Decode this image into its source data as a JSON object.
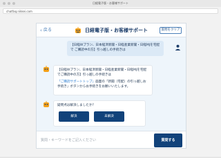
{
  "browser": {
    "window_title": "日経電子版・お客様サポート",
    "url": "chatfaq.nikkei.com"
  },
  "header": {
    "back_label": "戻る",
    "title": "日経電子版・お客様サポート",
    "clear_label": "質問をクリア"
  },
  "conversation": {
    "user_message": "【日経Wプラン、日本経済新聞・日経産業新聞・日経MJを宅配で ご購読中の方】引っ越しの手続きは",
    "bot_message_1": {
      "line1": "【日経Wプラン、日本経済新聞・日経産業新聞・日経MJを宅配でご購読中の方】引っ越しの手続きは",
      "link": "「ご購読サポートトップ」",
      "line2": "画面の「新聞（宅配）の引っ越しお手続き」ボタンからお手続きをお願いいたします。"
    },
    "bot_message_2": {
      "question": "疑問点は解決しましたか？",
      "yes_label": "解決",
      "no_label": "未解決"
    }
  },
  "input": {
    "placeholder": "質問・キーワードをご記入ください",
    "value": "",
    "send_label": "質問する"
  },
  "colors": {
    "accent": "#11427a",
    "link": "#2f7fd2",
    "user_bubble": "#dbe9f6",
    "bot_icon": "#f4a017"
  }
}
